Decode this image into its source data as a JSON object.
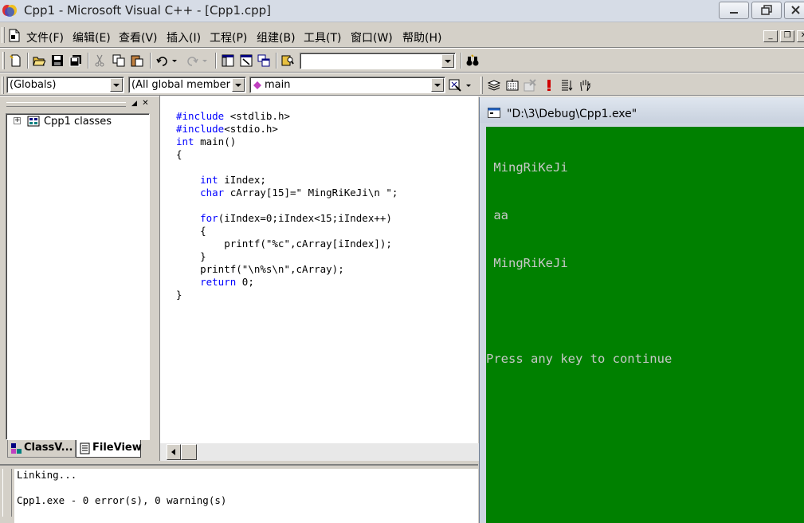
{
  "window": {
    "title": "Cpp1 - Microsoft Visual C++ - [Cpp1.cpp]"
  },
  "menu": {
    "items": [
      "文件(F)",
      "编辑(E)",
      "查看(V)",
      "插入(I)",
      "工程(P)",
      "组建(B)",
      "工具(T)",
      "窗口(W)",
      "帮助(H)"
    ]
  },
  "toolbar": {
    "find_combo_value": ""
  },
  "wizardbar": {
    "class_combo": "(Globals)",
    "filter_combo": "(All global member",
    "members_combo": "main"
  },
  "workspace": {
    "tree_root": "Cpp1 classes",
    "tabs": [
      "ClassV...",
      "FileView"
    ]
  },
  "editor": {
    "lines": [
      "#include <stdlib.h>",
      "#include<stdio.h>",
      "int main()",
      "{",
      "",
      "    int iIndex;",
      "    char cArray[15]=\" MingRiKeJi\\n \";",
      "",
      "    for(iIndex=0;iIndex<15;iIndex++)",
      "    {",
      "        printf(\"%c\",cArray[iIndex]);",
      "    }",
      "    printf(\"\\n%s\\n\",cArray);",
      "    return 0;",
      "}"
    ]
  },
  "output": {
    "lines": [
      "Linking...",
      "",
      "Cpp1.exe - 0 error(s), 0 warning(s)"
    ]
  },
  "console": {
    "title": "\"D:\\3\\Debug\\Cpp1.exe\"",
    "lines": [
      " MingRiKeJi",
      " aa",
      " MingRiKeJi",
      "",
      "Press any key to continue"
    ]
  },
  "colors": {
    "keyword": "#0000ff",
    "console_bg": "#008000",
    "console_fg": "#c8c8c8"
  }
}
